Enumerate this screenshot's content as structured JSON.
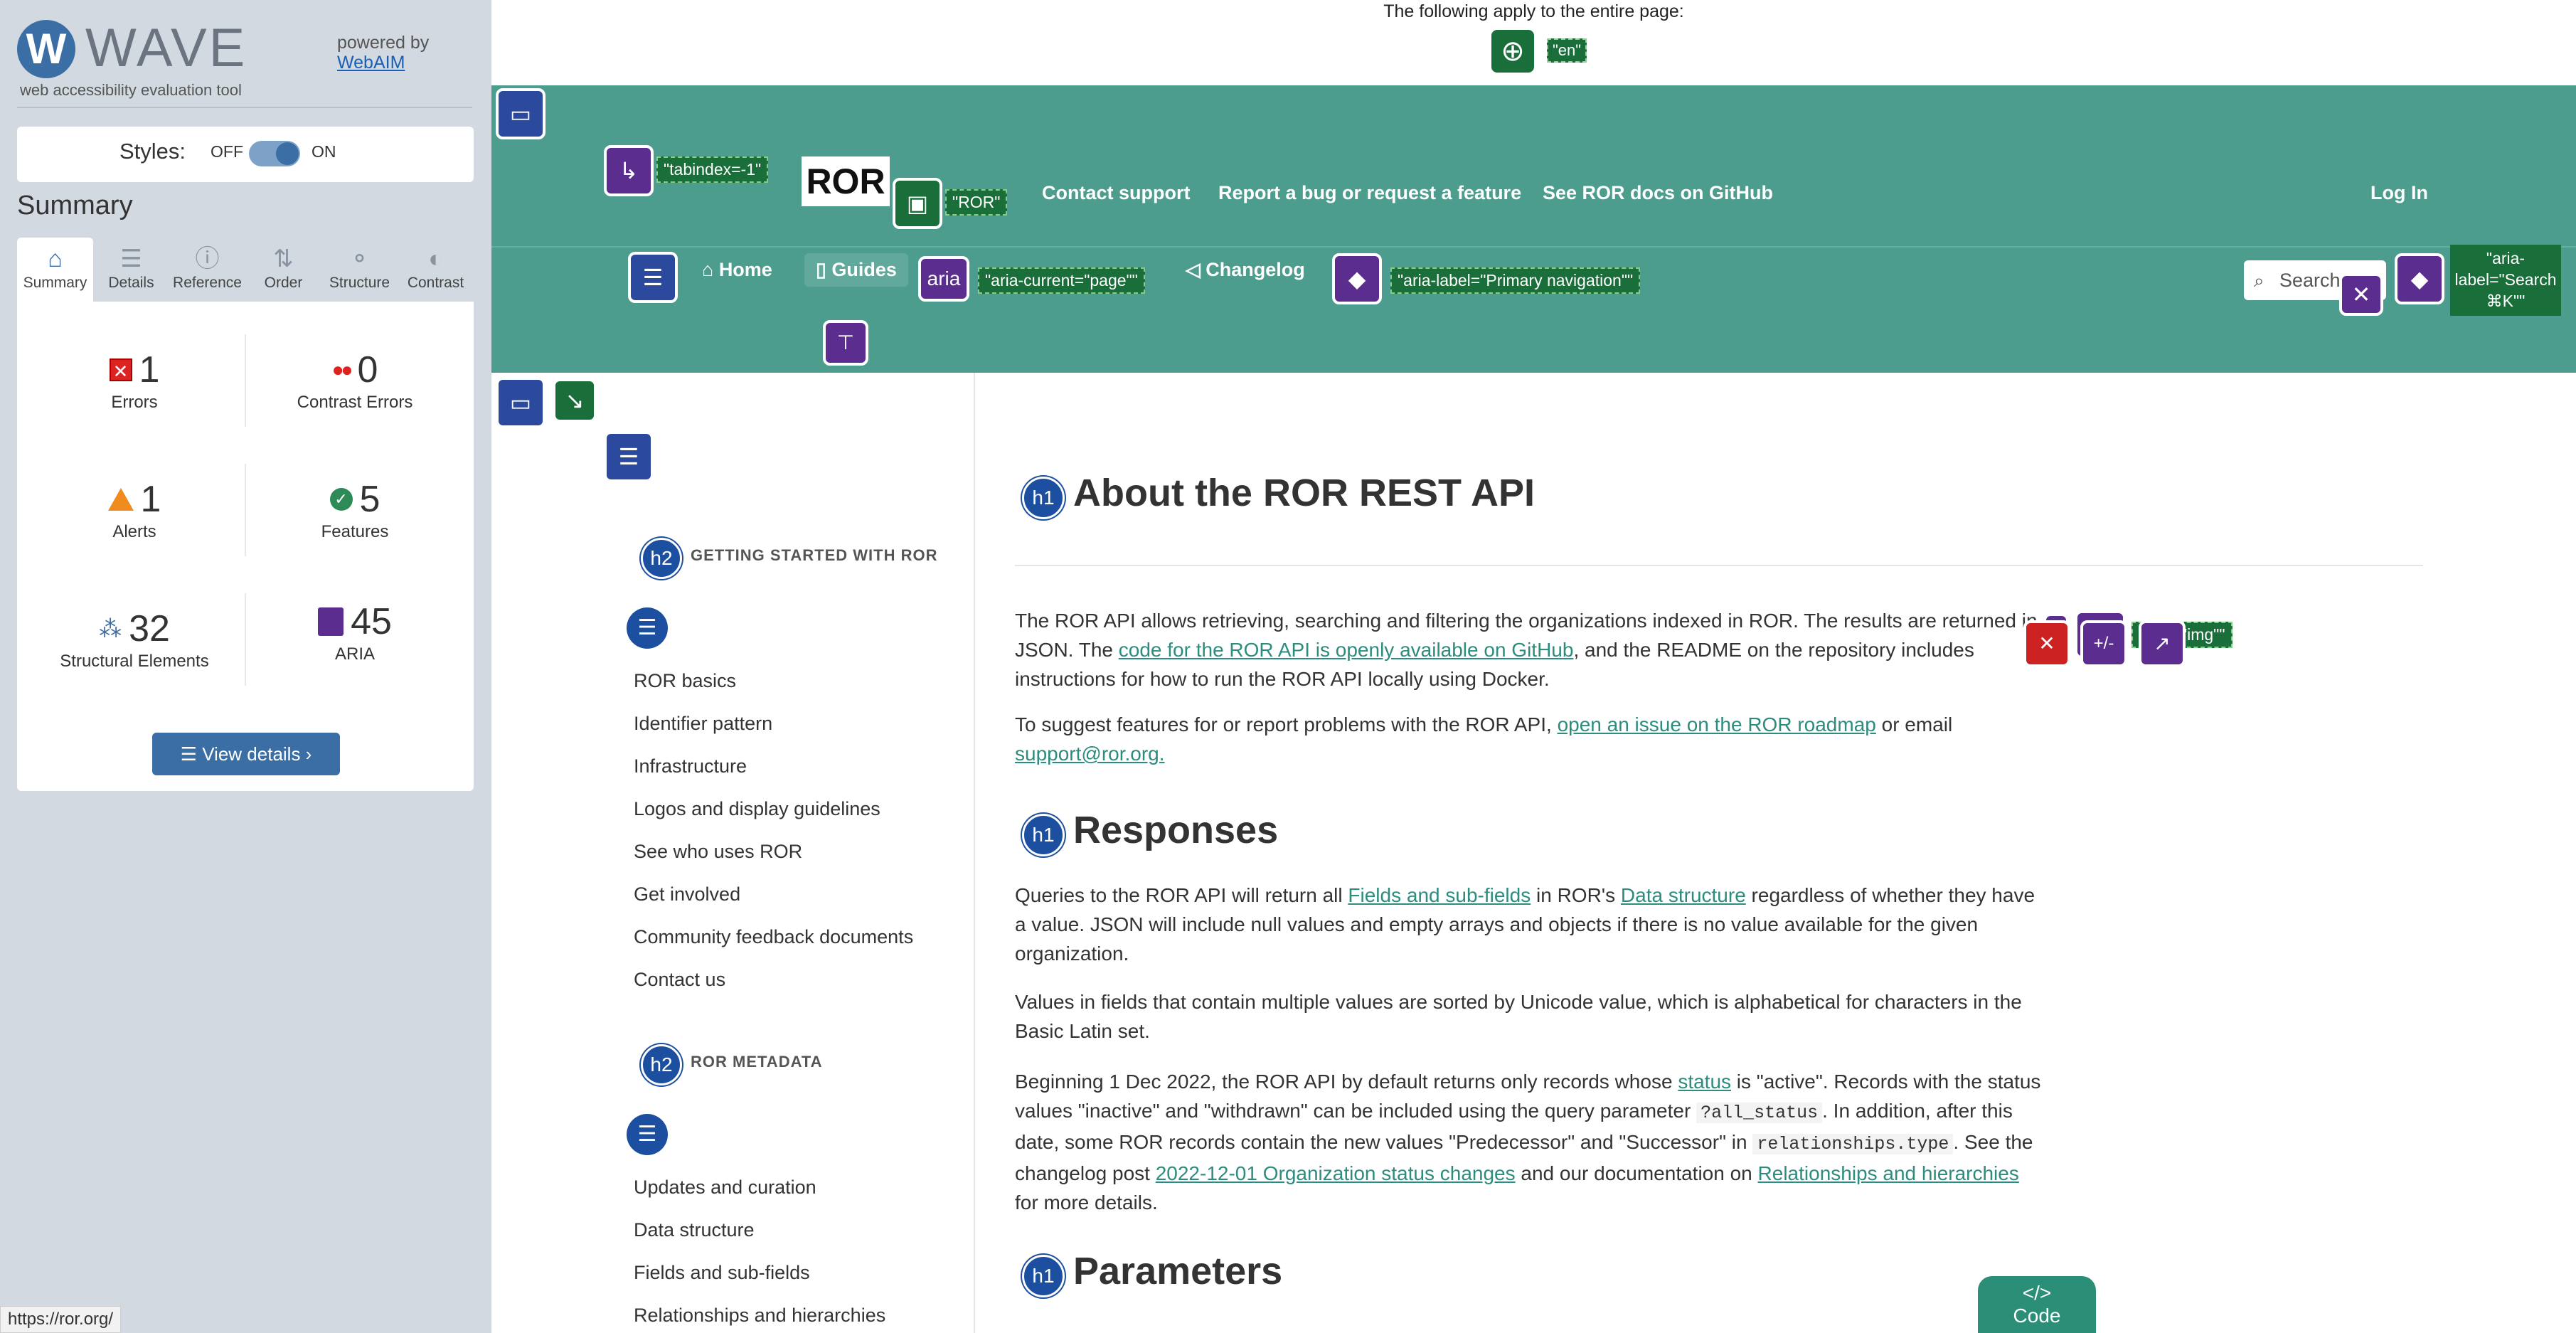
{
  "wave": {
    "title": "WAVE",
    "tagline": "web accessibility evaluation tool",
    "powered_by": "powered by",
    "webaim": "WebAIM",
    "styles_label": "Styles:",
    "styles_off": "OFF",
    "styles_on": "ON",
    "summary_heading": "Summary",
    "tabs": [
      {
        "label": "Summary",
        "icon": "home-icon"
      },
      {
        "label": "Details",
        "icon": "list-icon"
      },
      {
        "label": "Reference",
        "icon": "info-icon"
      },
      {
        "label": "Order",
        "icon": "order-icon"
      },
      {
        "label": "Structure",
        "icon": "structure-icon"
      },
      {
        "label": "Contrast",
        "icon": "contrast-icon"
      }
    ],
    "stats": {
      "errors": {
        "count": "1",
        "label": "Errors"
      },
      "contrast": {
        "count": "0",
        "label": "Contrast Errors"
      },
      "alerts": {
        "count": "1",
        "label": "Alerts"
      },
      "features": {
        "count": "5",
        "label": "Features"
      },
      "structural": {
        "count": "32",
        "label": "Structural Elements"
      },
      "aria": {
        "count": "45",
        "label": "ARIA"
      }
    },
    "view_details": "View details ›",
    "status_url": "https://ror.org/",
    "colors": {
      "accent": "#3a6ea5",
      "error": "#dd2222",
      "alert": "#f08c1e",
      "feature": "#2e8b57",
      "aria": "#5b2d8e"
    }
  },
  "page": {
    "note": "The following apply to the entire page:",
    "lang_chip": "\"en\"",
    "tabindex_chip": "\"tabindex=-1\"",
    "logo_text": "ROR",
    "logo_chip": "\"ROR\"",
    "top_links": [
      "Contact support",
      "Report a bug or request a feature",
      "See ROR docs on GitHub"
    ],
    "login": "Log In",
    "nav": {
      "home": "Home",
      "guides": "Guides",
      "aria_badge": "aria",
      "aria_current_chip": "\"aria-current=\"page\"\"",
      "changelog": "Changelog",
      "primary_nav_chip": "\"aria-label=\"Primary navigation\"\"",
      "search_placeholder": "Search",
      "search_aria_chip": "\"aria-label=\"Search ⌘K\"\""
    },
    "sidenav": {
      "sections": [
        {
          "heading": "GETTING STARTED WITH ROR",
          "items": [
            "ROR basics",
            "Identifier pattern",
            "Infrastructure",
            "Logos and display guidelines",
            "See who uses ROR",
            "Get involved",
            "Community feedback documents",
            "Contact us"
          ]
        },
        {
          "heading": "ROR METADATA",
          "items": [
            "Updates and curation",
            "Data structure",
            "Fields and sub-fields",
            "Relationships and hierarchies"
          ]
        }
      ]
    },
    "content": {
      "h1_badge": "h1",
      "h2_badge": "h2",
      "title": "About the ROR REST API",
      "p1_a": "The ROR API allows retrieving, searching and filtering the organizations indexed in ROR. The results are returned in JSON. The ",
      "p1_link": "code for the ROR API is openly available on GitHub",
      "p1_b": ", and the README on the repository includes instructions for how to run the ROR API locally using Docker.",
      "p2_a": "To suggest features for or report problems with the ROR API, ",
      "p2_link1": "open an issue on the ROR roadmap",
      "p2_b": " or email ",
      "p2_link2": "support@ror.org.",
      "role_img_chip": "\"role=\"img\"\"",
      "responses": "Responses",
      "p3_a": "Queries to the ROR API will return all ",
      "p3_link1": "Fields and sub-fields",
      "p3_b": " in ROR's ",
      "p3_link2": "Data structure",
      "p3_c": " regardless of whether they have a value. JSON will include null values and empty arrays and objects if there is no value available for the given organization.",
      "p4": "Values in fields that contain multiple values are sorted by Unicode value, which is alphabetical for characters in the Basic Latin set.",
      "p5_a": "Beginning 1 Dec 2022, the ROR API by default returns only records whose ",
      "p5_link1": "status",
      "p5_b": " is \"active\". Records with the status values \"inactive\" and \"withdrawn\" can be included using the query parameter ",
      "p5_code1": "?all_status",
      "p5_c": ". In addition, after this date, some ROR records contain the new values \"Predecessor\" and \"Successor\" in ",
      "p5_code2": "relationships.type",
      "p5_d": ". See the changelog post ",
      "p5_link2": "2022-12-01 Organization status changes",
      "p5_e": " and our documentation on ",
      "p5_link3": "Relationships and hierarchies",
      "p5_f": " for more details.",
      "parameters": "Parameters",
      "code_tab": "Code",
      "code_tab_icon": "</>",
      "plus_minus": "+/-"
    },
    "colors": {
      "header": "#4d9d8f",
      "link": "#2c8c7d",
      "wave_blue": "#2b4a9e",
      "wave_green": "#1a6e3a"
    }
  }
}
